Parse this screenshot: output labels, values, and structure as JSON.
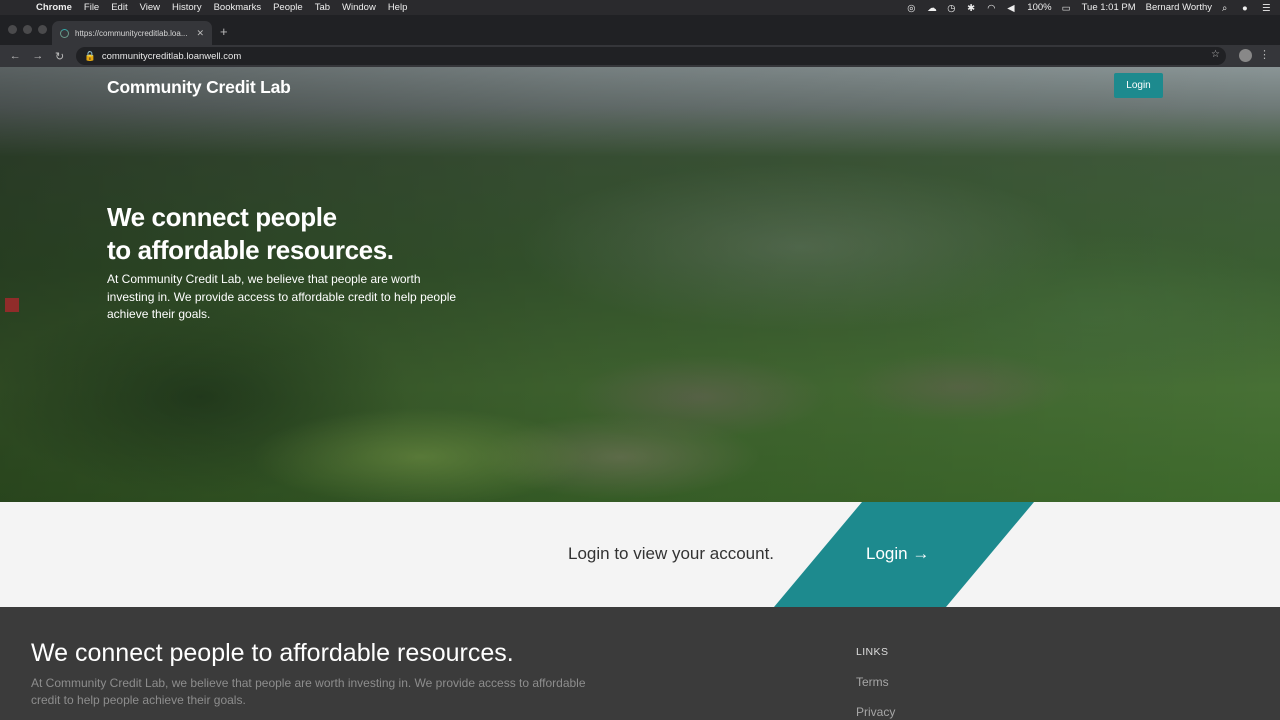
{
  "menubar": {
    "apple": "",
    "items": [
      "Chrome",
      "File",
      "Edit",
      "View",
      "History",
      "Bookmarks",
      "People",
      "Tab",
      "Window",
      "Help"
    ],
    "battery": "100%",
    "clock": "Tue 1:01 PM",
    "user": "Bernard Worthy"
  },
  "browser": {
    "tab_title": "https://communitycreditlab.loa...",
    "new_tab": "+",
    "url": "communitycreditlab.loanwell.com"
  },
  "hero": {
    "brand": "Community Credit Lab",
    "login_label": "Login",
    "headline_line1": "We connect people",
    "headline_line2": "to affordable resources.",
    "subtext": "At Community Credit Lab, we believe that people are worth investing in. We provide access to affordable credit to help people achieve their goals."
  },
  "band": {
    "prompt": "Login to view your account.",
    "login_label": "Login →"
  },
  "footer": {
    "title": "We connect people to affordable resources.",
    "text": "At Community Credit Lab, we believe that people are worth investing in. We provide access to affordable credit to help people achieve their goals.",
    "links_heading": "LINKS",
    "links": [
      "Terms",
      "Privacy"
    ]
  },
  "colors": {
    "accent": "#1d8a8e",
    "footer_bg": "#3b3b3b",
    "band_bg": "#f4f4f4"
  }
}
